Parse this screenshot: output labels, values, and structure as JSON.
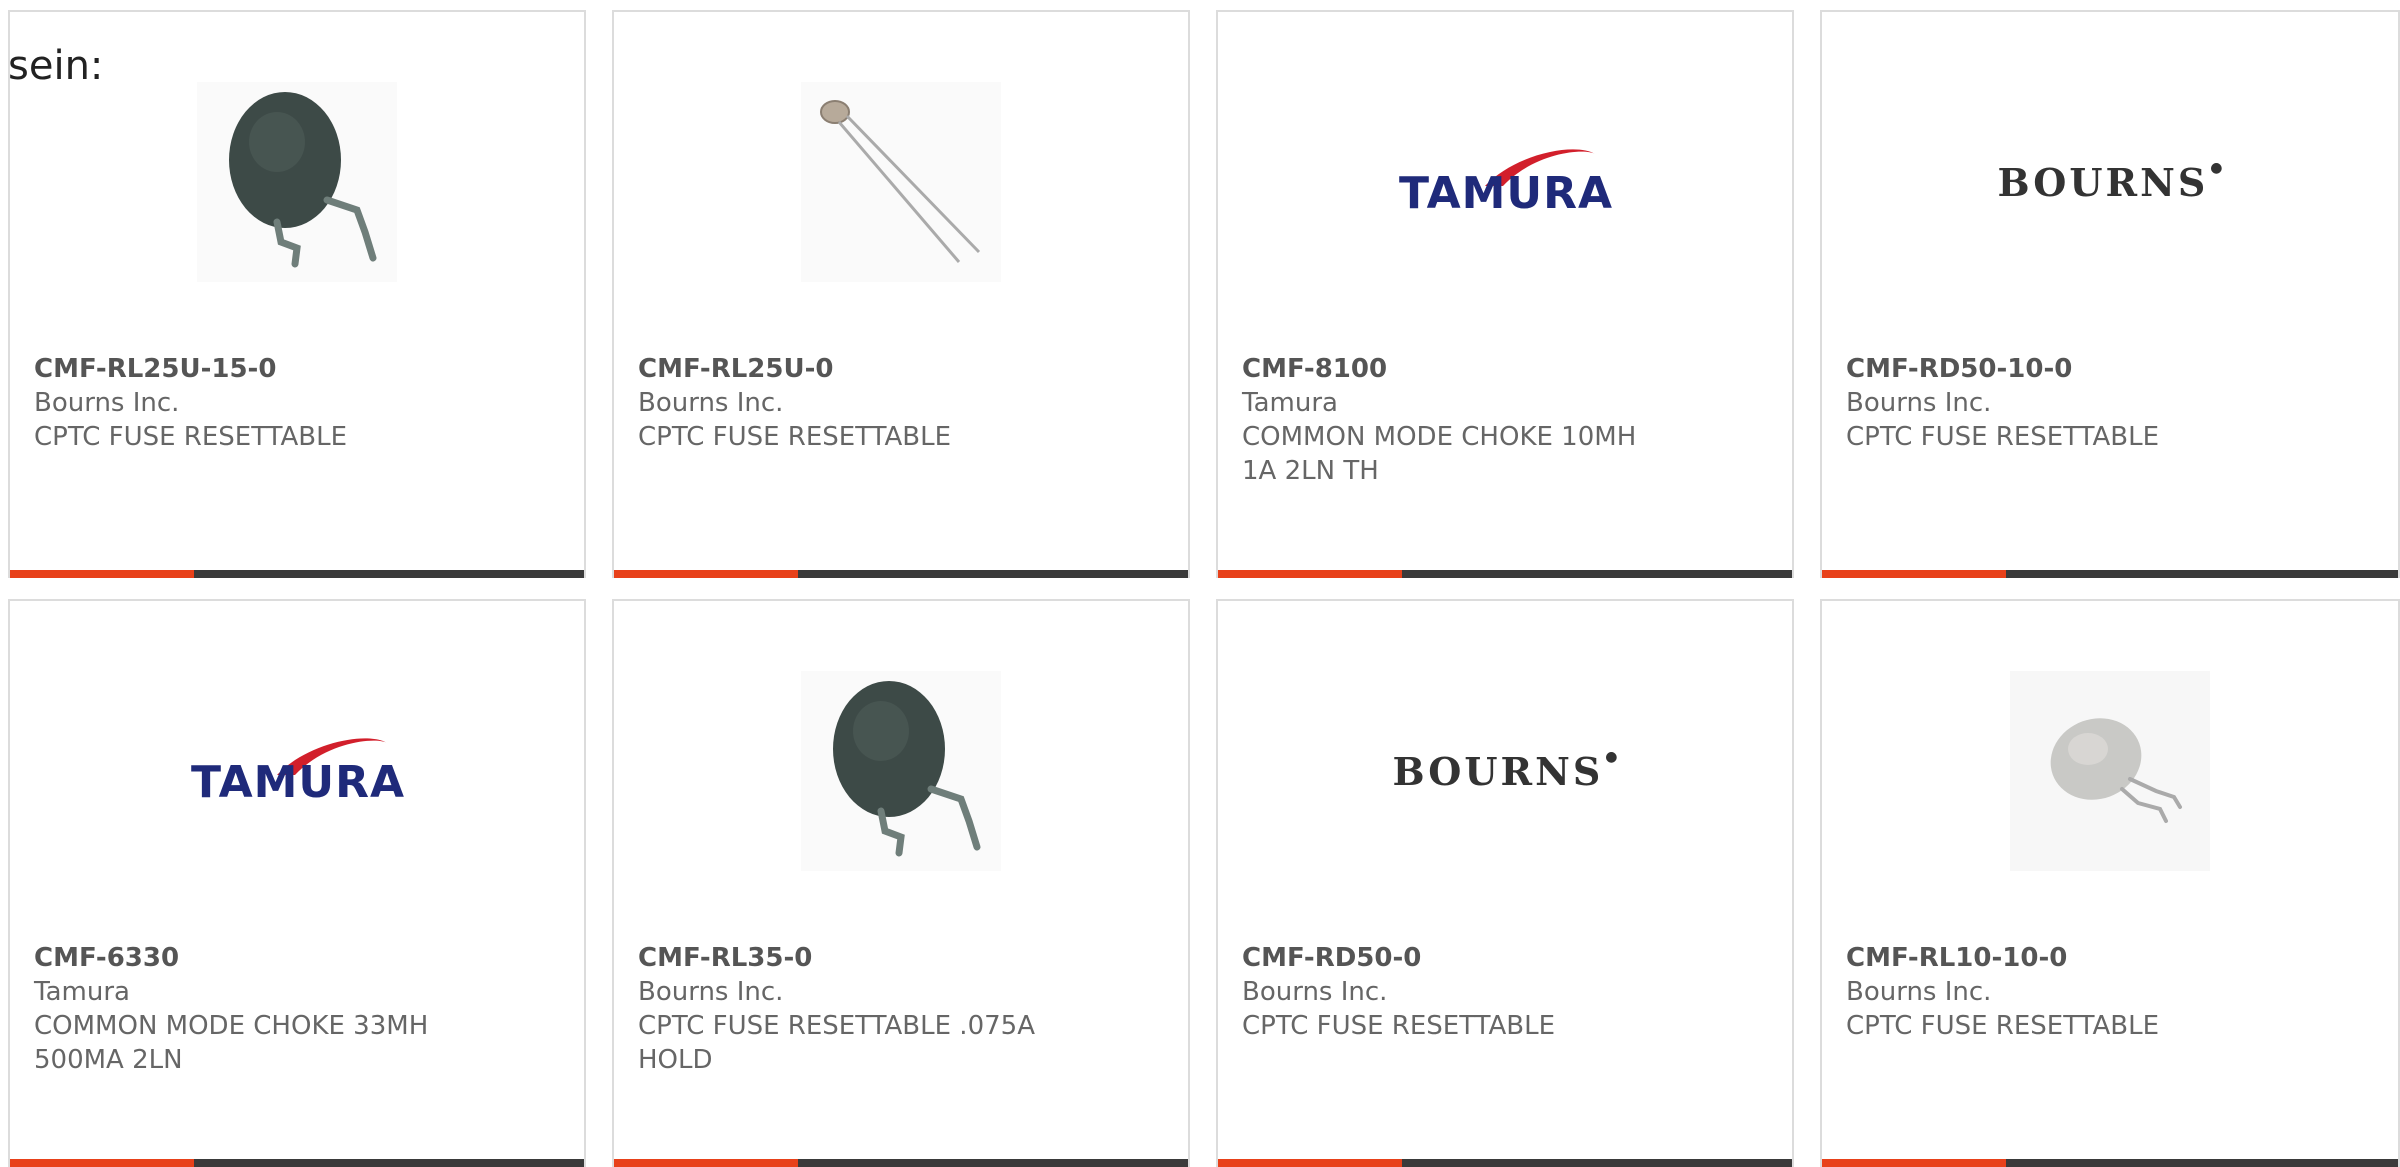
{
  "intro_text": "sein:",
  "colors": {
    "accent": "#e8411a",
    "bar": "#3a3a3a",
    "tamura_blue": "#1f2a7a",
    "tamura_red": "#d21f2b"
  },
  "products": [
    {
      "part": "CMF-RL25U-15-0",
      "manufacturer": "Bourns Inc.",
      "description": "CPTC FUSE RESETTABLE",
      "image": "dark-green-ptc-thermistor-icon"
    },
    {
      "part": "CMF-RL25U-0",
      "manufacturer": "Bourns Inc.",
      "description": "CPTC FUSE RESETTABLE",
      "image": "small-ptc-thermistor-icon"
    },
    {
      "part": "CMF-8100",
      "manufacturer": "Tamura",
      "description": "COMMON MODE CHOKE 10MH 1A 2LN TH",
      "image": "tamura-logo",
      "logo_text": "TAMURA"
    },
    {
      "part": "CMF-RD50-10-0",
      "manufacturer": "Bourns Inc.",
      "description": "CPTC FUSE RESETTABLE",
      "image": "bourns-logo",
      "logo_text": "BOURNS"
    },
    {
      "part": "CMF-6330",
      "manufacturer": "Tamura",
      "description": "COMMON MODE CHOKE 33MH 500MA 2LN",
      "image": "tamura-logo",
      "logo_text": "TAMURA"
    },
    {
      "part": "CMF-RL35-0",
      "manufacturer": "Bourns Inc.",
      "description": "CPTC FUSE RESETTABLE .075A HOLD",
      "image": "dark-green-ptc-thermistor-icon"
    },
    {
      "part": "CMF-RD50-0",
      "manufacturer": "Bourns Inc.",
      "description": "CPTC FUSE RESETTABLE",
      "image": "bourns-logo",
      "logo_text": "BOURNS"
    },
    {
      "part": "CMF-RL10-10-0",
      "manufacturer": "Bourns Inc.",
      "description": "CPTC FUSE RESETTABLE",
      "image": "grey-ptc-thermistor-icon"
    }
  ]
}
